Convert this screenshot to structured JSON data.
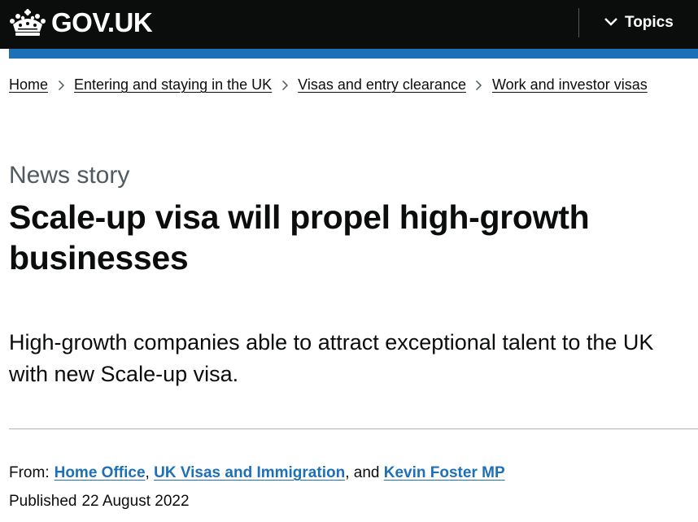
{
  "header": {
    "logo_text": "GOV.UK",
    "topics_label": "Topics",
    "brand_color": "#1d70b8"
  },
  "breadcrumb": {
    "items": [
      {
        "label": "Home"
      },
      {
        "label": "Entering and staying in the UK"
      },
      {
        "label": "Visas and entry clearance"
      },
      {
        "label": "Work and investor visas"
      }
    ]
  },
  "article": {
    "caption": "News story",
    "title": "Scale-up visa will propel high-growth businesses",
    "lede": "High-growth companies able to attract exceptional talent to the UK with new Scale-up visa."
  },
  "metadata": {
    "from_label": "From:",
    "organisations": [
      {
        "label": "Home Office"
      },
      {
        "label": "UK Visas and Immigration"
      },
      {
        "label": "Kevin Foster MP"
      }
    ],
    "separator_comma": ",",
    "separator_and": ", and",
    "published_label": "Published",
    "published_date": "22 August 2022"
  }
}
